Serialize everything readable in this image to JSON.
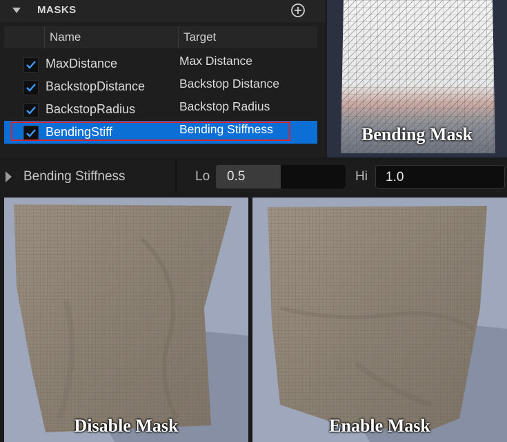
{
  "masks_panel": {
    "title": "MASKS",
    "columns": {
      "name": "Name",
      "target": "Target"
    },
    "rows": [
      {
        "name": "MaxDistance",
        "target": "Max Distance",
        "checked": true,
        "selected": false
      },
      {
        "name": "BackstopDistance",
        "target": "Backstop Distance",
        "checked": true,
        "selected": false
      },
      {
        "name": "BackstopRadius",
        "target": "Backstop Radius",
        "checked": true,
        "selected": false
      },
      {
        "name": "BendingStiff",
        "target": "Bending Stiffness",
        "checked": true,
        "selected": true
      }
    ]
  },
  "mask_preview": {
    "caption": "Bending Mask"
  },
  "property": {
    "label": "Bending Stiffness",
    "lo_label": "Lo",
    "lo_value": "0.5",
    "lo_fill_fraction": 0.5,
    "hi_label": "Hi",
    "hi_value": "1.0"
  },
  "renders": {
    "left_caption": "Disable Mask",
    "right_caption": "Enable Mask"
  },
  "colors": {
    "selection": "#0b6fd6",
    "highlight_outline": "#d8232a",
    "checkmark": "#3d9bff",
    "cloth": "#8f8577",
    "background": "#9ea7bb"
  },
  "icons": [
    "chevron-down-icon",
    "add-circle-icon",
    "checkmark-icon",
    "expand-arrow-icon"
  ]
}
